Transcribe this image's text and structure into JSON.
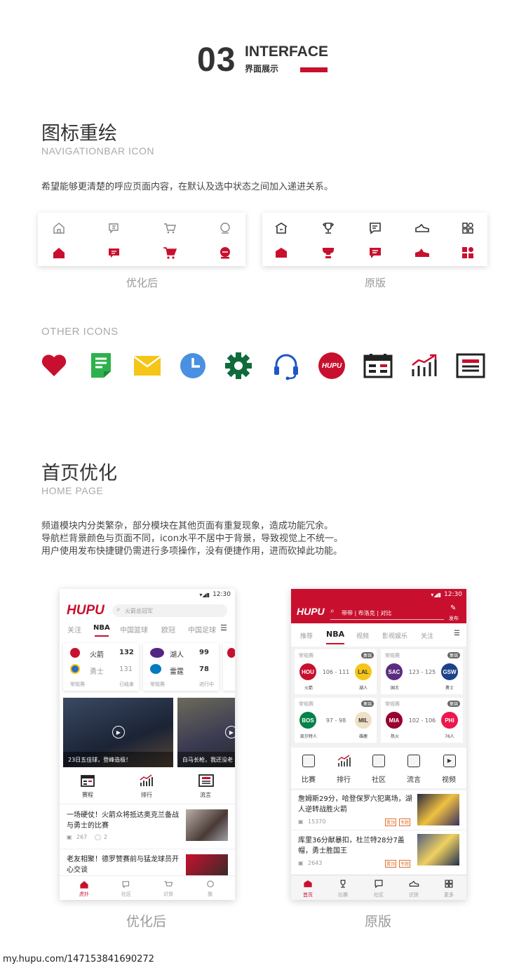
{
  "header": {
    "number": "03",
    "title_en": "INTERFACE",
    "title_cn": "界面展示"
  },
  "section1": {
    "title": "图标重绘",
    "subtitle": "NAVIGATIONBAR ICON",
    "description": "希望能够更清楚的呼应页面内容，在默认及选中状态之间加入递进关系。",
    "caption_optimized": "优化后",
    "caption_original": "原版",
    "other_icons_label": "OTHER ICONS",
    "other_icons": [
      "heart-icon",
      "document-icon",
      "mail-icon",
      "clock-icon",
      "gear-icon",
      "headset-icon",
      "hupu-logo-icon",
      "calendar-icon",
      "chart-icon",
      "news-icon"
    ]
  },
  "section2": {
    "title": "首页优化",
    "subtitle": "HOME PAGE",
    "description": [
      "频道模块内分类繁杂，部分模块在其他页面有重复现象，造成功能冗余。",
      "导航栏背景颜色与页面不同，icon水平不居中于背景，导致视觉上不统一。",
      "用户使用发布快捷键仍需进行多项操作，没有便捷作用，进而砍掉此功能。"
    ],
    "caption_optimized": "优化后",
    "caption_original": "原版"
  },
  "phone_new": {
    "time": "12:30",
    "logo": "HUPU",
    "search_placeholder": "火箭总冠军",
    "tabs": [
      "关注",
      "NBA",
      "中国篮球",
      "欧冠",
      "中国足球"
    ],
    "games": [
      {
        "t1": "火箭",
        "s1": "132",
        "t2": "勇士",
        "s2": "131",
        "type": "常规赛",
        "status": "已结束"
      },
      {
        "t1": "湖人",
        "s1": "99",
        "t2": "雷霆",
        "s2": "78",
        "type": "常规赛",
        "status": "进行中"
      }
    ],
    "banners": [
      "23日五佳球，登峰造极！",
      "白马长枪，我还没老"
    ],
    "quick": [
      "赛程",
      "排行",
      "流言"
    ],
    "news": [
      {
        "title": "一场硬仗！火箭众将抵达奥克兰备战与勇士的比赛",
        "views": "267",
        "comments": "2"
      },
      {
        "title": "老友相聚！德罗赞赛前与猛龙球员开心交谈"
      }
    ],
    "nav": [
      "虎扑",
      "社区",
      "识货",
      "我"
    ]
  },
  "phone_old": {
    "time": "12:30",
    "logo": "HUPU",
    "search_text": "带带 | 布洛克 | 对比",
    "publish": "发布",
    "tabs": [
      "推荐",
      "NBA",
      "视频",
      "影视娱乐",
      "关注"
    ],
    "games": [
      {
        "type": "常规赛",
        "tag": "集锦",
        "a": "HOU",
        "b": "LAL",
        "score": "106 - 111",
        "an": "火箭",
        "bn": "湖人"
      },
      {
        "type": "常规赛",
        "tag": "集锦",
        "a": "SAC",
        "b": "GSW",
        "score": "123 - 125",
        "an": "国王",
        "bn": "勇士"
      },
      {
        "type": "常规赛",
        "tag": "集锦",
        "a": "BOS",
        "b": "MIL",
        "score": "97 - 98",
        "an": "凯尔特人",
        "bn": "雄鹿"
      },
      {
        "type": "常规赛",
        "tag": "集锦",
        "a": "MIA",
        "b": "PHI",
        "score": "102 - 106",
        "an": "热火",
        "bn": "76人"
      }
    ],
    "quick": [
      "比赛",
      "排行",
      "社区",
      "流言",
      "视频"
    ],
    "news": [
      {
        "title": "詹姆斯29分，哈登保罗六犯离场，湖人逆转战胜火箭",
        "views": "15370",
        "tags": [
          "置顶",
          "专题"
        ]
      },
      {
        "title": "库里36分献暴扣，杜兰特28分7盖帽，勇士胜国王",
        "views": "2643",
        "tags": [
          "置顶",
          "专题"
        ]
      }
    ],
    "nav": [
      "首页",
      "比赛",
      "社区",
      "识货",
      "更多"
    ]
  },
  "watermark": "my.hupu.com/147153841690272",
  "colors": {
    "accent": "#c8102e"
  }
}
